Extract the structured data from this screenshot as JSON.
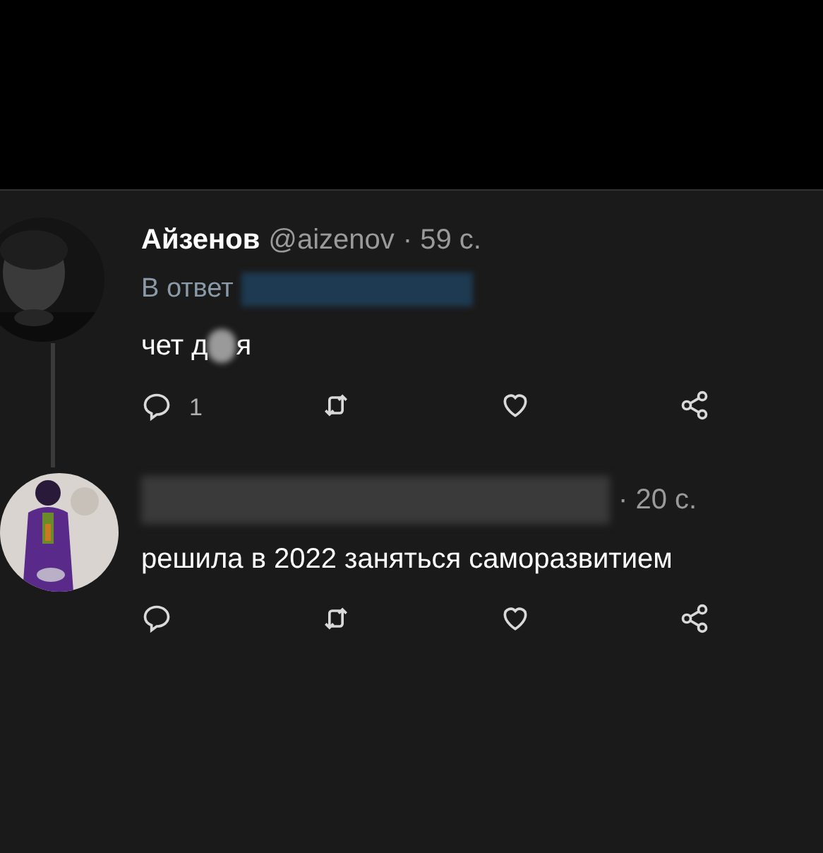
{
  "tweets": [
    {
      "author": {
        "censored": false,
        "name": "Айзенов",
        "handle": "@aizenov"
      },
      "time": "· 59 с.",
      "reply_to": {
        "label": "В ответ",
        "censored": true
      },
      "text_segments": [
        "чет д",
        "я"
      ],
      "reply_count": "1",
      "thread_line": true
    },
    {
      "author": {
        "censored": true
      },
      "time": "· 20 с.",
      "text_segments": [
        "решила в 2022 заняться саморазвитием"
      ],
      "thread_line": false
    }
  ]
}
